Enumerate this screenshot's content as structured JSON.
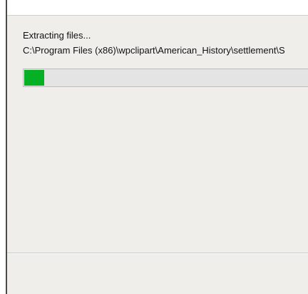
{
  "extraction": {
    "status": "Extracting files...",
    "current_path": "C:\\Program Files (x86)\\wpclipart\\American_History\\settlement\\S",
    "progress_fraction": 0.07
  },
  "colors": {
    "progress": "#06b025",
    "window_bg": "#efeeeb"
  }
}
